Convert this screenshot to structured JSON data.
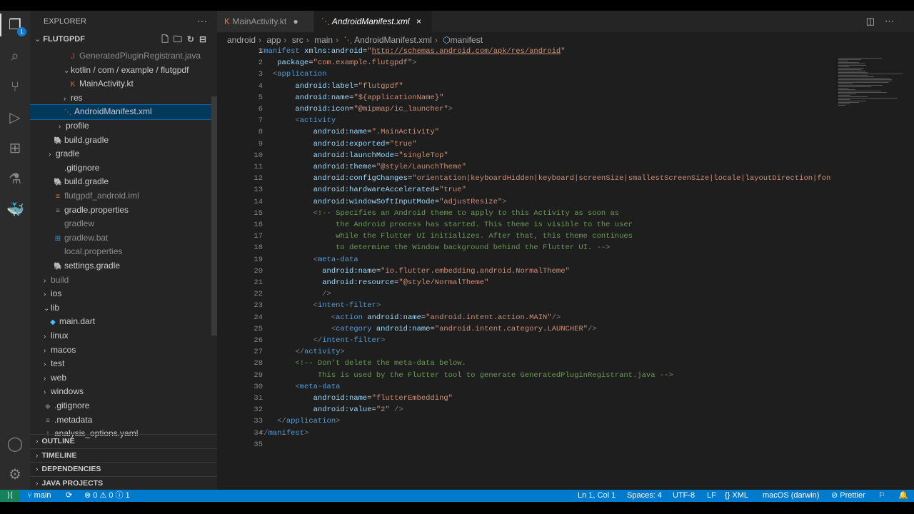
{
  "sidebar": {
    "title": "EXPLORER",
    "more": "···",
    "project": "FLUTGPDF",
    "items": [
      {
        "label": "GeneratedPluginRegistrant.java",
        "depth": 6,
        "type": "file",
        "icon": "J",
        "iconColor": "#e05252",
        "dim": true
      },
      {
        "label": "kotlin / com / example / flutgpdf",
        "depth": 5,
        "type": "folder-open"
      },
      {
        "label": "MainActivity.kt",
        "depth": 6,
        "type": "file",
        "icon": "K",
        "iconColor": "#e37933"
      },
      {
        "label": "res",
        "depth": 5,
        "type": "folder"
      },
      {
        "label": "AndroidManifest.xml",
        "depth": 5,
        "type": "file",
        "icon": "⋱",
        "iconColor": "#e37933",
        "selected": true
      },
      {
        "label": "profile",
        "depth": 4,
        "type": "folder"
      },
      {
        "label": "build.gradle",
        "depth": 3,
        "type": "file",
        "icon": "🐘",
        "iconColor": "#4a90a4"
      },
      {
        "label": "gradle",
        "depth": 2,
        "type": "folder"
      },
      {
        "label": ".gitignore",
        "depth": 3,
        "type": "file",
        "icon": "",
        "iconColor": "#888"
      },
      {
        "label": "build.gradle",
        "depth": 3,
        "type": "file",
        "icon": "🐘",
        "iconColor": "#4a90a4"
      },
      {
        "label": "flutgpdf_android.iml",
        "depth": 3,
        "type": "file",
        "icon": "≡",
        "iconColor": "#e37933",
        "dim": true
      },
      {
        "label": "gradle.properties",
        "depth": 3,
        "type": "file",
        "icon": "≡",
        "iconColor": "#888"
      },
      {
        "label": "gradlew",
        "depth": 3,
        "type": "file",
        "icon": "",
        "iconColor": "#888",
        "dim": true
      },
      {
        "label": "gradlew.bat",
        "depth": 3,
        "type": "file",
        "icon": "⊞",
        "iconColor": "#3a96dd",
        "dim": true
      },
      {
        "label": "local.properties",
        "depth": 3,
        "type": "file",
        "icon": "",
        "iconColor": "#888",
        "dim": true
      },
      {
        "label": "settings.gradle",
        "depth": 3,
        "type": "file",
        "icon": "🐘",
        "iconColor": "#4a90a4"
      },
      {
        "label": "build",
        "depth": 1,
        "type": "folder",
        "dim": true
      },
      {
        "label": "ios",
        "depth": 1,
        "type": "folder"
      },
      {
        "label": "lib",
        "depth": 1,
        "type": "folder-open"
      },
      {
        "label": "main.dart",
        "depth": 2,
        "type": "file",
        "icon": "◆",
        "iconColor": "#40c4ff"
      },
      {
        "label": "linux",
        "depth": 1,
        "type": "folder"
      },
      {
        "label": "macos",
        "depth": 1,
        "type": "folder"
      },
      {
        "label": "test",
        "depth": 1,
        "type": "folder"
      },
      {
        "label": "web",
        "depth": 1,
        "type": "folder"
      },
      {
        "label": "windows",
        "depth": 1,
        "type": "folder"
      },
      {
        "label": ".gitignore",
        "depth": 1,
        "type": "file",
        "icon": "◆",
        "iconColor": "#666"
      },
      {
        "label": ".metadata",
        "depth": 1,
        "type": "file",
        "icon": "≡",
        "iconColor": "#888"
      },
      {
        "label": "analysis_options.yaml",
        "depth": 1,
        "type": "file",
        "icon": "!",
        "iconColor": "#a074c4"
      }
    ],
    "sections": [
      "OUTLINE",
      "TIMELINE",
      "DEPENDENCIES",
      "JAVA PROJECTS"
    ]
  },
  "activity": {
    "explorer_badge": "1"
  },
  "tabs": [
    {
      "label": "MainActivity.kt",
      "modified": "●"
    },
    {
      "label": "AndroidManifest.xml",
      "close": "×"
    }
  ],
  "breadcrumb": [
    "android",
    "app",
    "src",
    "main",
    "AndroidManifest.xml",
    "manifest"
  ],
  "code": [
    [
      [
        "p",
        "<"
      ],
      [
        "t",
        "manifest"
      ],
      [
        "x",
        " "
      ],
      [
        "a",
        "xmlns:android"
      ],
      [
        "x",
        "="
      ],
      [
        "s",
        "\""
      ],
      [
        "u",
        "http://schemas.android.com/apk/res/android"
      ],
      [
        "s",
        "\""
      ]
    ],
    [
      [
        "x",
        "    "
      ],
      [
        "a",
        "package"
      ],
      [
        "x",
        "="
      ],
      [
        "s",
        "\"com.example.flutgpdf\""
      ],
      [
        "p",
        ">"
      ]
    ],
    [
      [
        "x",
        "   "
      ],
      [
        "p",
        "<"
      ],
      [
        "t",
        "application"
      ]
    ],
    [
      [
        "x",
        "        "
      ],
      [
        "a",
        "android:label"
      ],
      [
        "x",
        "="
      ],
      [
        "s",
        "\"flutgpdf\""
      ]
    ],
    [
      [
        "x",
        "        "
      ],
      [
        "a",
        "android:name"
      ],
      [
        "x",
        "="
      ],
      [
        "s",
        "\"${applicationName}\""
      ]
    ],
    [
      [
        "x",
        "        "
      ],
      [
        "a",
        "android:icon"
      ],
      [
        "x",
        "="
      ],
      [
        "s",
        "\"@mipmap/ic_launcher\""
      ],
      [
        "p",
        ">"
      ]
    ],
    [
      [
        "x",
        "        "
      ],
      [
        "p",
        "<"
      ],
      [
        "t",
        "activity"
      ]
    ],
    [
      [
        "x",
        "            "
      ],
      [
        "a",
        "android:name"
      ],
      [
        "x",
        "="
      ],
      [
        "s",
        "\".MainActivity\""
      ]
    ],
    [
      [
        "x",
        "            "
      ],
      [
        "a",
        "android:exported"
      ],
      [
        "x",
        "="
      ],
      [
        "s",
        "\"true\""
      ]
    ],
    [
      [
        "x",
        "            "
      ],
      [
        "a",
        "android:launchMode"
      ],
      [
        "x",
        "="
      ],
      [
        "s",
        "\"singleTop\""
      ]
    ],
    [
      [
        "x",
        "            "
      ],
      [
        "a",
        "android:theme"
      ],
      [
        "x",
        "="
      ],
      [
        "s",
        "\"@style/LaunchTheme\""
      ]
    ],
    [
      [
        "x",
        "            "
      ],
      [
        "a",
        "android:configChanges"
      ],
      [
        "x",
        "="
      ],
      [
        "s",
        "\"orientation|keyboardHidden|keyboard|screenSize|smallestScreenSize|locale|layoutDirection|fontScale|screenLayout|density|uiMode\""
      ]
    ],
    [
      [
        "x",
        "            "
      ],
      [
        "a",
        "android:hardwareAccelerated"
      ],
      [
        "x",
        "="
      ],
      [
        "s",
        "\"true\""
      ]
    ],
    [
      [
        "x",
        "            "
      ],
      [
        "a",
        "android:windowSoftInputMode"
      ],
      [
        "x",
        "="
      ],
      [
        "s",
        "\"adjustResize\""
      ],
      [
        "p",
        ">"
      ]
    ],
    [
      [
        "x",
        "            "
      ],
      [
        "c",
        "<!-- Specifies an Android theme to apply to this Activity as soon as"
      ]
    ],
    [
      [
        "c",
        "                 the Android process has started. This theme is visible to the user"
      ]
    ],
    [
      [
        "c",
        "                 while the Flutter UI initializes. After that, this theme continues"
      ]
    ],
    [
      [
        "c",
        "                 to determine the Window background behind the Flutter UI. -->"
      ]
    ],
    [
      [
        "x",
        "            "
      ],
      [
        "p",
        "<"
      ],
      [
        "t",
        "meta-data"
      ]
    ],
    [
      [
        "x",
        "              "
      ],
      [
        "a",
        "android:name"
      ],
      [
        "x",
        "="
      ],
      [
        "s",
        "\"io.flutter.embedding.android.NormalTheme\""
      ]
    ],
    [
      [
        "x",
        "              "
      ],
      [
        "a",
        "android:resource"
      ],
      [
        "x",
        "="
      ],
      [
        "s",
        "\"@style/NormalTheme\""
      ]
    ],
    [
      [
        "x",
        "              "
      ],
      [
        "p",
        "/>"
      ]
    ],
    [
      [
        "x",
        "            "
      ],
      [
        "p",
        "<"
      ],
      [
        "t",
        "intent-filter"
      ],
      [
        "p",
        ">"
      ]
    ],
    [
      [
        "x",
        "                "
      ],
      [
        "p",
        "<"
      ],
      [
        "t",
        "action"
      ],
      [
        "x",
        " "
      ],
      [
        "a",
        "android:name"
      ],
      [
        "x",
        "="
      ],
      [
        "s",
        "\"android.intent.action.MAIN\""
      ],
      [
        "p",
        "/>"
      ]
    ],
    [
      [
        "x",
        "                "
      ],
      [
        "p",
        "<"
      ],
      [
        "t",
        "category"
      ],
      [
        "x",
        " "
      ],
      [
        "a",
        "android:name"
      ],
      [
        "x",
        "="
      ],
      [
        "s",
        "\"android.intent.category.LAUNCHER\""
      ],
      [
        "p",
        "/>"
      ]
    ],
    [
      [
        "x",
        "            "
      ],
      [
        "p",
        "</"
      ],
      [
        "t",
        "intent-filter"
      ],
      [
        "p",
        ">"
      ]
    ],
    [
      [
        "x",
        "        "
      ],
      [
        "p",
        "</"
      ],
      [
        "t",
        "activity"
      ],
      [
        "p",
        ">"
      ]
    ],
    [
      [
        "x",
        "        "
      ],
      [
        "c",
        "<!-- Don't delete the meta-data below."
      ]
    ],
    [
      [
        "c",
        "             This is used by the Flutter tool to generate GeneratedPluginRegistrant.java -->"
      ]
    ],
    [
      [
        "x",
        "        "
      ],
      [
        "p",
        "<"
      ],
      [
        "t",
        "meta-data"
      ]
    ],
    [
      [
        "x",
        "            "
      ],
      [
        "a",
        "android:name"
      ],
      [
        "x",
        "="
      ],
      [
        "s",
        "\"flutterEmbedding\""
      ]
    ],
    [
      [
        "x",
        "            "
      ],
      [
        "a",
        "android:value"
      ],
      [
        "x",
        "="
      ],
      [
        "s",
        "\"2\""
      ],
      [
        "x",
        " "
      ],
      [
        "p",
        "/>"
      ]
    ],
    [
      [
        "x",
        "    "
      ],
      [
        "p",
        "</"
      ],
      [
        "t",
        "application"
      ],
      [
        "p",
        ">"
      ]
    ],
    [
      [
        "p",
        "</"
      ],
      [
        "t",
        "manifest"
      ],
      [
        "p",
        ">"
      ]
    ],
    []
  ],
  "status": {
    "branch": "main",
    "errors": "0",
    "warnings": "0",
    "info": "1",
    "position": "Ln 1, Col 1",
    "spaces": "Spaces: 4",
    "encoding": "UTF-8",
    "eol": "LF",
    "language": "XML",
    "platform": "macOS (darwin)",
    "formatter": "Prettier"
  }
}
